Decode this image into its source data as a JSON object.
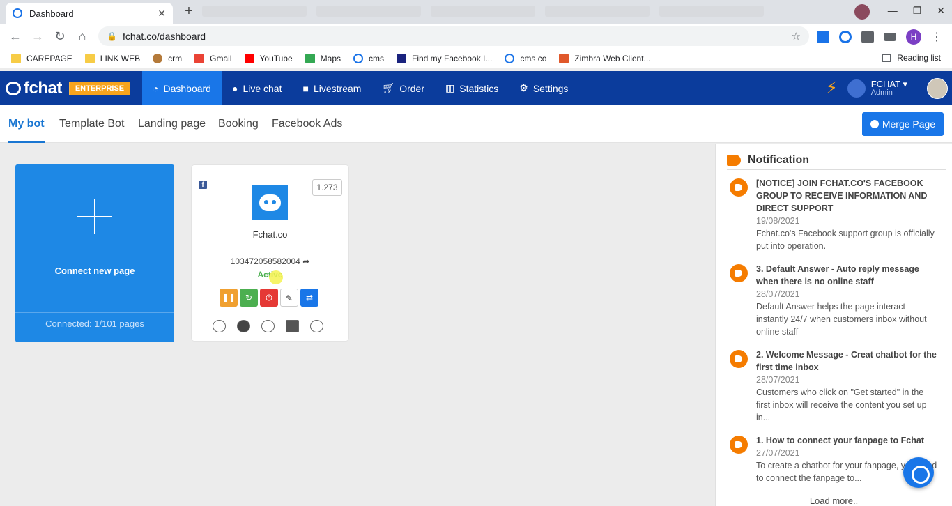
{
  "browser": {
    "tab_title": "Dashboard",
    "url": "fchat.co/dashboard",
    "bookmarks": [
      {
        "label": "CAREPAGE",
        "icon": "folder-icon"
      },
      {
        "label": "LINK WEB",
        "icon": "folder-icon"
      },
      {
        "label": "crm",
        "icon": "crm-icon"
      },
      {
        "label": "Gmail",
        "icon": "gmail-icon"
      },
      {
        "label": "YouTube",
        "icon": "youtube-icon"
      },
      {
        "label": "Maps",
        "icon": "maps-icon"
      },
      {
        "label": "cms",
        "icon": "fchat-icon"
      },
      {
        "label": "Find my Facebook I...",
        "icon": "l-icon"
      },
      {
        "label": "cms co",
        "icon": "fchat-icon"
      },
      {
        "label": "Zimbra Web Client...",
        "icon": "zimbra-icon"
      }
    ],
    "reading_list": "Reading list",
    "profile_initial": "H"
  },
  "app": {
    "logo_name": "fchat",
    "plan_badge": "ENTERPRISE",
    "nav": [
      {
        "label": "Dashboard",
        "icon": "dashboard-icon",
        "active": true
      },
      {
        "label": "Live chat",
        "icon": "chat-icon"
      },
      {
        "label": "Livestream",
        "icon": "video-icon"
      },
      {
        "label": "Order",
        "icon": "cart-icon"
      },
      {
        "label": "Statistics",
        "icon": "chart-icon"
      },
      {
        "label": "Settings",
        "icon": "gear-icon"
      }
    ],
    "user": {
      "name": "FCHAT",
      "role": "Admin"
    }
  },
  "subnav": {
    "tabs": [
      "My bot",
      "Template Bot",
      "Landing page",
      "Booking",
      "Facebook Ads"
    ],
    "active": "My bot",
    "merge_label": "Merge Page"
  },
  "connect_card": {
    "label": "Connect new page",
    "connected": "Connected: 1/101 pages"
  },
  "bot_card": {
    "count": "1.273",
    "name": "Fchat.co",
    "page_id": "103472058582004",
    "status": "Active"
  },
  "notifications": {
    "title": "Notification",
    "items": [
      {
        "title": "[NOTICE] JOIN FCHAT.CO'S FACEBOOK GROUP TO RECEIVE INFORMATION AND DIRECT SUPPORT",
        "date": "19/08/2021",
        "desc": "Fchat.co's Facebook support group is officially put into operation."
      },
      {
        "title": "3. Default Answer - Auto reply message when there is no online staff",
        "date": "28/07/2021",
        "desc": "Default Answer helps the page interact instantly 24/7 when customers inbox without online staff"
      },
      {
        "title": "2. Welcome Message - Creat chatbot for the first time inbox",
        "date": "28/07/2021",
        "desc": "Customers who click on \"Get started\" in the first inbox will receive the content you set up in..."
      },
      {
        "title": "1. How to connect your fanpage to Fchat",
        "date": "27/07/2021",
        "desc": "To create a chatbot for your fanpage, you need to connect the fanpage to..."
      }
    ],
    "load_more": "Load more.."
  }
}
